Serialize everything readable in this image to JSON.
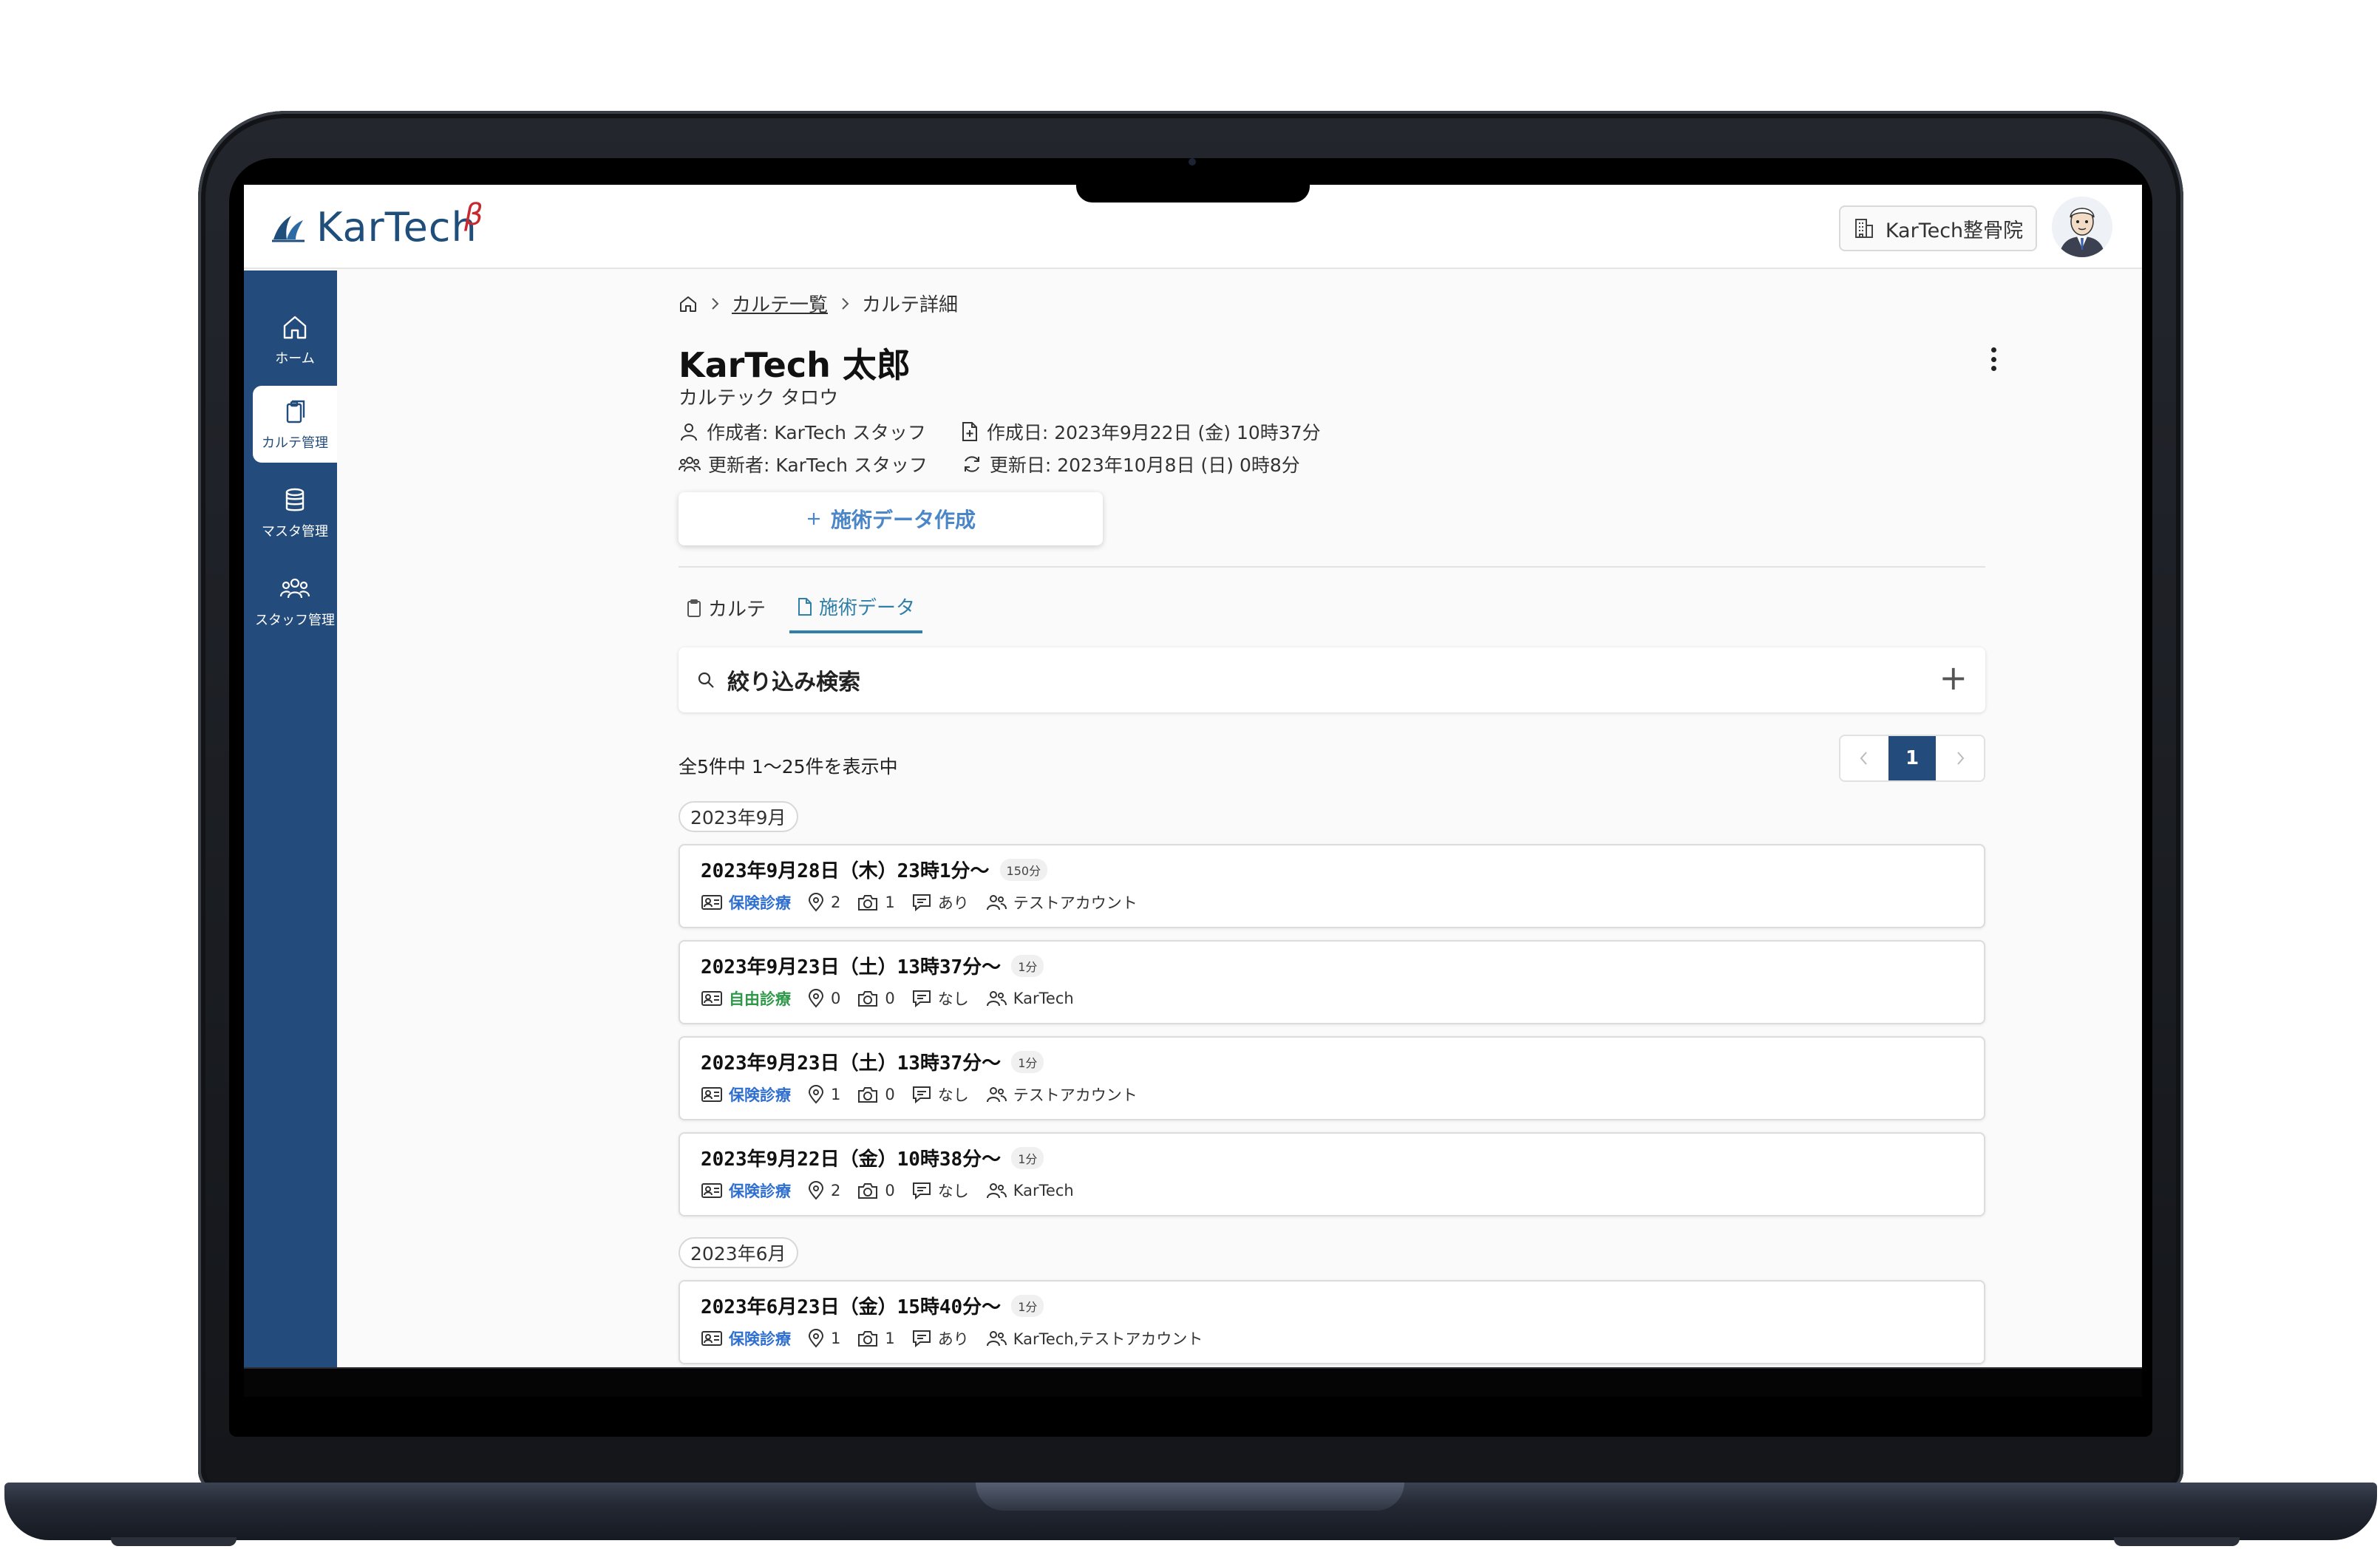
{
  "header": {
    "logo_text": "KarTech",
    "logo_beta": "β",
    "clinic_name": "KarTech整骨院"
  },
  "sidebar": {
    "items": [
      {
        "label": "ホーム",
        "icon": "home-icon"
      },
      {
        "label": "カルテ管理",
        "icon": "clipboard-copy-icon"
      },
      {
        "label": "マスタ管理",
        "icon": "database-icon"
      },
      {
        "label": "スタッフ管理",
        "icon": "staff-group-icon"
      }
    ]
  },
  "breadcrumb": {
    "list": "カルテ一覧",
    "current": "カルテ詳細"
  },
  "patient": {
    "name": "KarTech 太郎",
    "kana": "カルテック タロウ",
    "creator": "作成者: KarTech スタッフ",
    "created": "作成日: 2023年9月22日 (金) 10時37分",
    "updater": "更新者: KarTech スタッフ",
    "updated": "更新日: 2023年10月8日 (日) 0時8分"
  },
  "actions": {
    "create_label": "施術データ作成"
  },
  "tabs": [
    {
      "label": "カルテ"
    },
    {
      "label": "施術データ"
    }
  ],
  "search": {
    "label": "絞り込み検索"
  },
  "list": {
    "count": "全5件中 1〜25件を表示中",
    "page": "1"
  },
  "groups": [
    {
      "month": "2023年9月",
      "records": [
        {
          "title": "2023年9月28日（木）23時1分〜",
          "duration": "150分",
          "type": "保険診療",
          "type_color": "#2f6fd0",
          "points": "2",
          "photos": "1",
          "comment": "あり",
          "staff": "テストアカウント"
        },
        {
          "title": "2023年9月23日（土）13時37分〜",
          "duration": "1分",
          "type": "自由診療",
          "type_color": "#2e9a49",
          "points": "0",
          "photos": "0",
          "comment": "なし",
          "staff": "KarTech"
        },
        {
          "title": "2023年9月23日（土）13時37分〜",
          "duration": "1分",
          "type": "保険診療",
          "type_color": "#2f6fd0",
          "points": "1",
          "photos": "0",
          "comment": "なし",
          "staff": "テストアカウント"
        },
        {
          "title": "2023年9月22日（金）10時38分〜",
          "duration": "1分",
          "type": "保険診療",
          "type_color": "#2f6fd0",
          "points": "2",
          "photos": "0",
          "comment": "なし",
          "staff": "KarTech"
        }
      ]
    },
    {
      "month": "2023年6月",
      "records": [
        {
          "title": "2023年6月23日（金）15時40分〜",
          "duration": "1分",
          "type": "保険診療",
          "type_color": "#2f6fd0",
          "points": "1",
          "photos": "1",
          "comment": "あり",
          "staff": "KarTech,テストアカウント"
        }
      ]
    }
  ]
}
